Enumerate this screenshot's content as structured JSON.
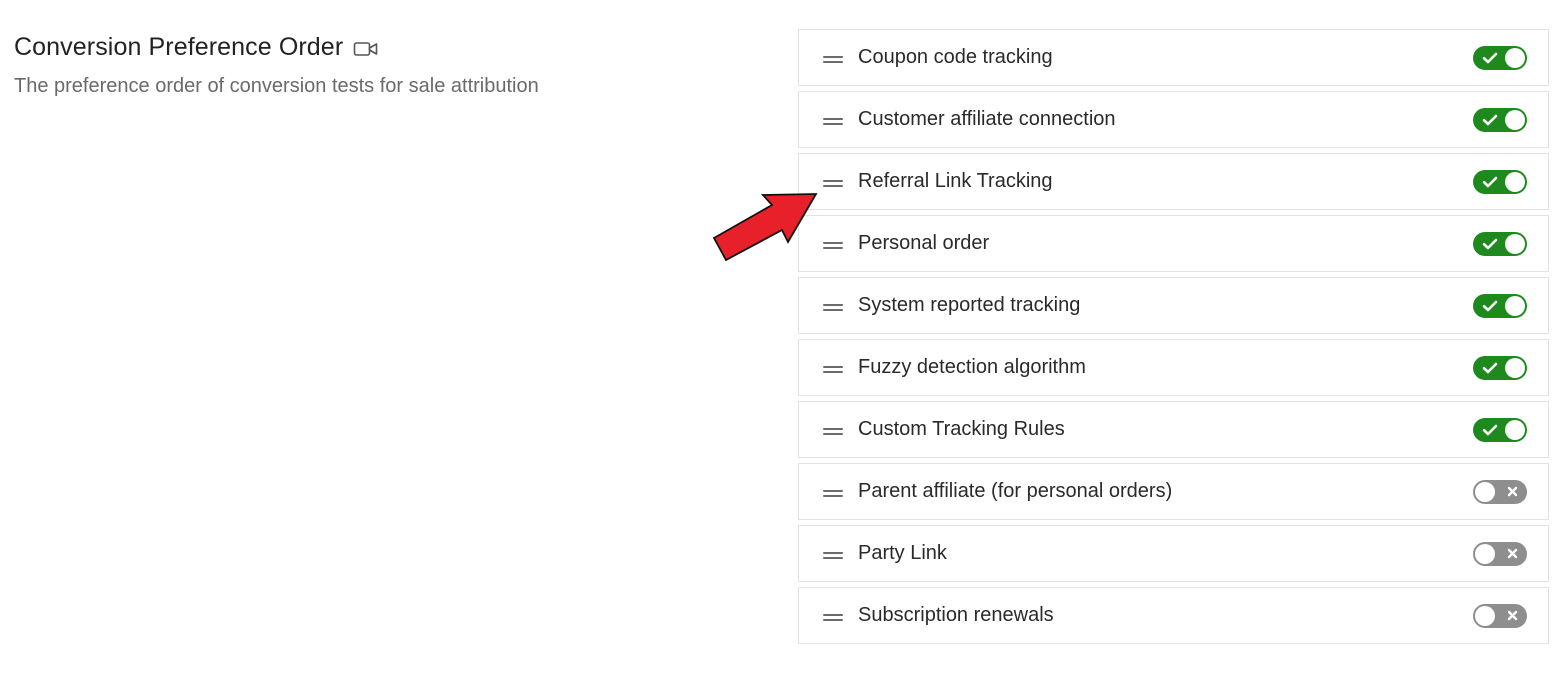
{
  "section": {
    "title": "Conversion Preference Order",
    "description": "The preference order of conversion tests for sale attribution",
    "title_icon": "video-camera-icon"
  },
  "items": [
    {
      "label": "Coupon code tracking",
      "enabled": true
    },
    {
      "label": "Customer affiliate connection",
      "enabled": true
    },
    {
      "label": "Referral Link Tracking",
      "enabled": true
    },
    {
      "label": "Personal order",
      "enabled": true
    },
    {
      "label": "System reported tracking",
      "enabled": true
    },
    {
      "label": "Fuzzy detection algorithm",
      "enabled": true
    },
    {
      "label": "Custom Tracking Rules",
      "enabled": true
    },
    {
      "label": "Parent affiliate (for personal orders)",
      "enabled": false
    },
    {
      "label": "Party Link",
      "enabled": false
    },
    {
      "label": "Subscription renewals",
      "enabled": false
    }
  ],
  "colors": {
    "toggle_on": "#1e8a1e",
    "toggle_off": "#8e8e8e",
    "annotation_arrow": "#e8202a"
  },
  "icons": {
    "drag_handle": "drag-handle-icon",
    "toggle_on_mark": "check-icon",
    "toggle_off_mark": "x-icon",
    "annotation": "red-arrow-annotation"
  }
}
